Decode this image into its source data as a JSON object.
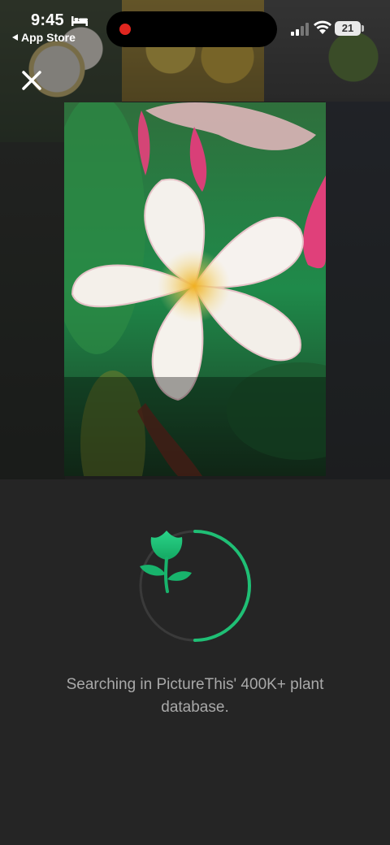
{
  "status_bar": {
    "time": "9:45",
    "back_label": "App Store",
    "battery_level": "21"
  },
  "close": {
    "icon": "close-icon"
  },
  "scan": {
    "progress": 0.5,
    "accent_color": "#1fbf75",
    "message": "Searching in PictureThis' 400K+ plant database."
  }
}
